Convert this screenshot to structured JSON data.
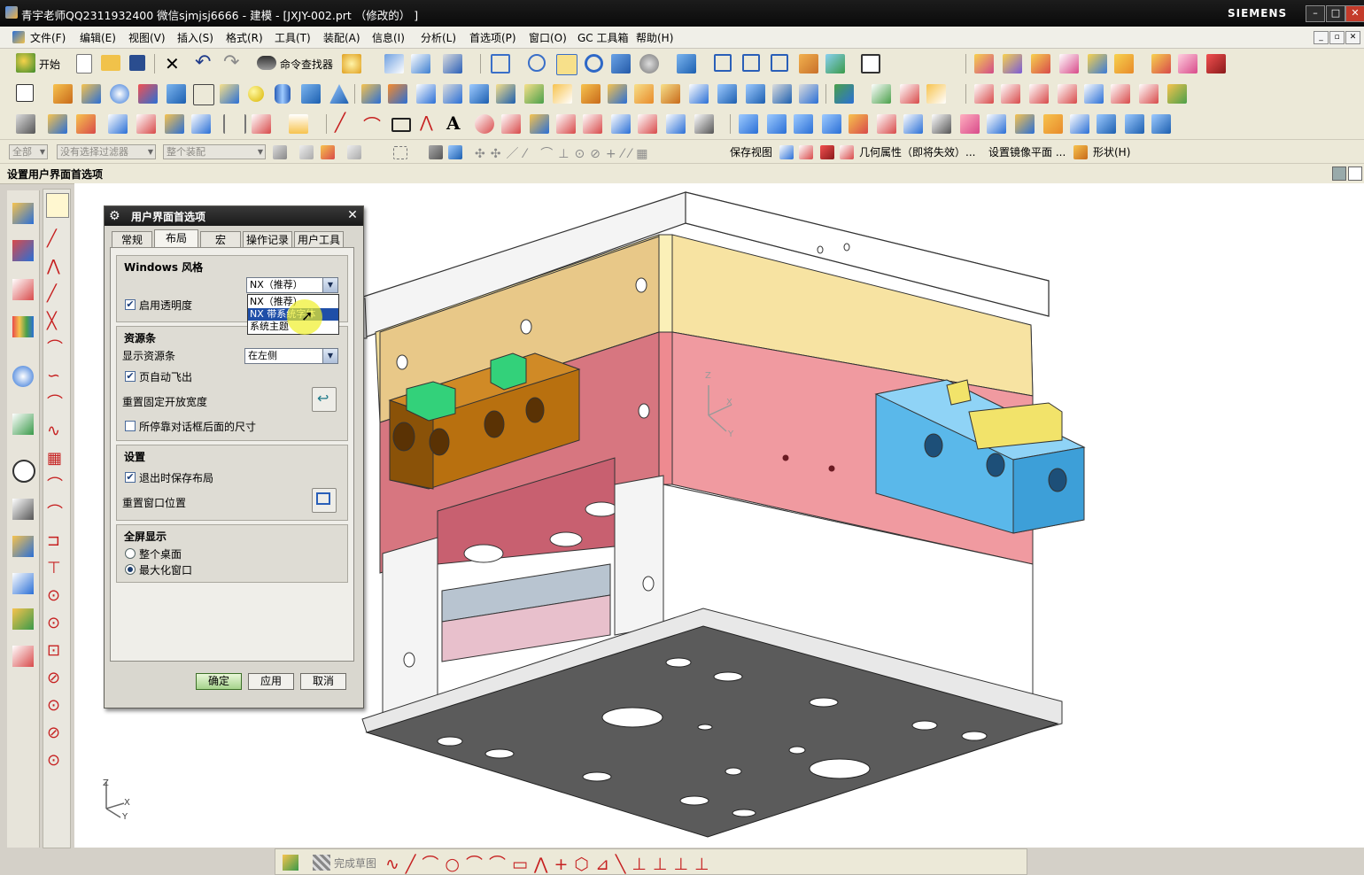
{
  "window": {
    "title": "青宇老师QQ2311932400 微信sjmjsj6666 - 建模 - [JXJY-002.prt （修改的） ]",
    "brand": "SIEMENS",
    "controls": [
      "–",
      "□",
      "✕"
    ]
  },
  "menubar": {
    "items": [
      "文件(F)",
      "编辑(E)",
      "视图(V)",
      "插入(S)",
      "格式(R)",
      "工具(T)",
      "装配(A)",
      "信息(I)",
      "分析(L)",
      "首选项(P)",
      "窗口(O)",
      "GC 工具箱",
      "帮助(H)"
    ]
  },
  "toolbar": {
    "start_label": "开始",
    "command_finder_label": "命令查找器"
  },
  "selection_bar": {
    "filter_all": "全部",
    "filter_none": "没有选择过滤器",
    "scope": "整个装配",
    "save_view": "保存视图",
    "geometry_props": "几何属性（即将失效）...",
    "mirror_plane": "设置镜像平面 ...",
    "shape": "形状(H)"
  },
  "cue_line": "设置用户界面首选项",
  "dialog": {
    "title": "用户界面首选项",
    "tabs": [
      "常规",
      "布局",
      "宏",
      "操作记录",
      "用户工具"
    ],
    "active_tab": "布局",
    "windows_style": {
      "heading": "Windows 风格",
      "selected": "NX（推荐）",
      "options": [
        "NX（推荐）",
        "NX 带系统字体",
        "系统主题"
      ],
      "highlighted_option": "NX 带系统字体",
      "transparency_label": "启用透明度",
      "transparency_checked": true
    },
    "resource_bar": {
      "heading": "资源条",
      "display_label": "显示资源条",
      "display_value": "在左侧",
      "auto_flyout_label": "页自动飞出",
      "auto_flyout_checked": true,
      "reset_width_label": "重置固定开放宽度",
      "dock_size_label": "所停靠对话框后面的尺寸",
      "dock_size_checked": false
    },
    "settings": {
      "heading": "设置",
      "save_layout_label": "退出时保存布局",
      "save_layout_checked": true,
      "reset_window_label": "重置窗口位置"
    },
    "fullscreen": {
      "heading": "全屏显示",
      "option_desktop": "整个桌面",
      "option_maximize": "最大化窗口",
      "selected": "最大化窗口"
    },
    "buttons": {
      "ok": "确定",
      "apply": "应用",
      "cancel": "取消"
    }
  },
  "viewport": {
    "triad_labels": [
      "Z",
      "X",
      "Y"
    ]
  },
  "bottom_toolbar": {
    "finish_sketch": "完成草图"
  },
  "colors": {
    "titlebar": "#141414",
    "plate_pink": "#ef8c92",
    "plate_yellow": "#f4dd98",
    "slider_blue": "#5ab8ea",
    "slider_brown": "#b8700f",
    "insert_green": "#33d17a",
    "bottom_plate": "#5b5b5b",
    "ok_button": "#a5d38c"
  }
}
